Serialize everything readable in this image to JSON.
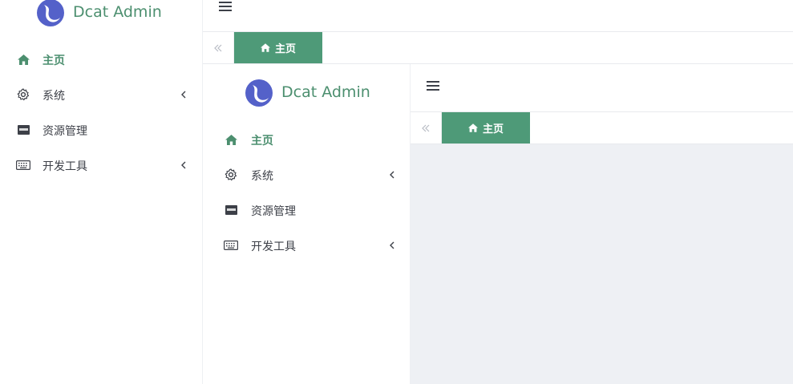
{
  "brand": {
    "title": "Dcat Admin"
  },
  "sidebar": {
    "items": [
      {
        "label": "主页",
        "icon": "home-icon",
        "active": true
      },
      {
        "label": "系统",
        "icon": "gear-icon",
        "has_submenu": true
      },
      {
        "label": "资源管理",
        "icon": "media-icon"
      },
      {
        "label": "开发工具",
        "icon": "keyboard-icon",
        "has_submenu": true
      }
    ]
  },
  "header": {
    "menu_icon": "hamburger-icon"
  },
  "tabs": {
    "collapse_icon": "double-chevron-left-icon",
    "home_label": "主页"
  },
  "colors": {
    "accent": "#4e9a78",
    "brand_text": "#4c8f6f",
    "content_bg": "#eef0f4"
  }
}
